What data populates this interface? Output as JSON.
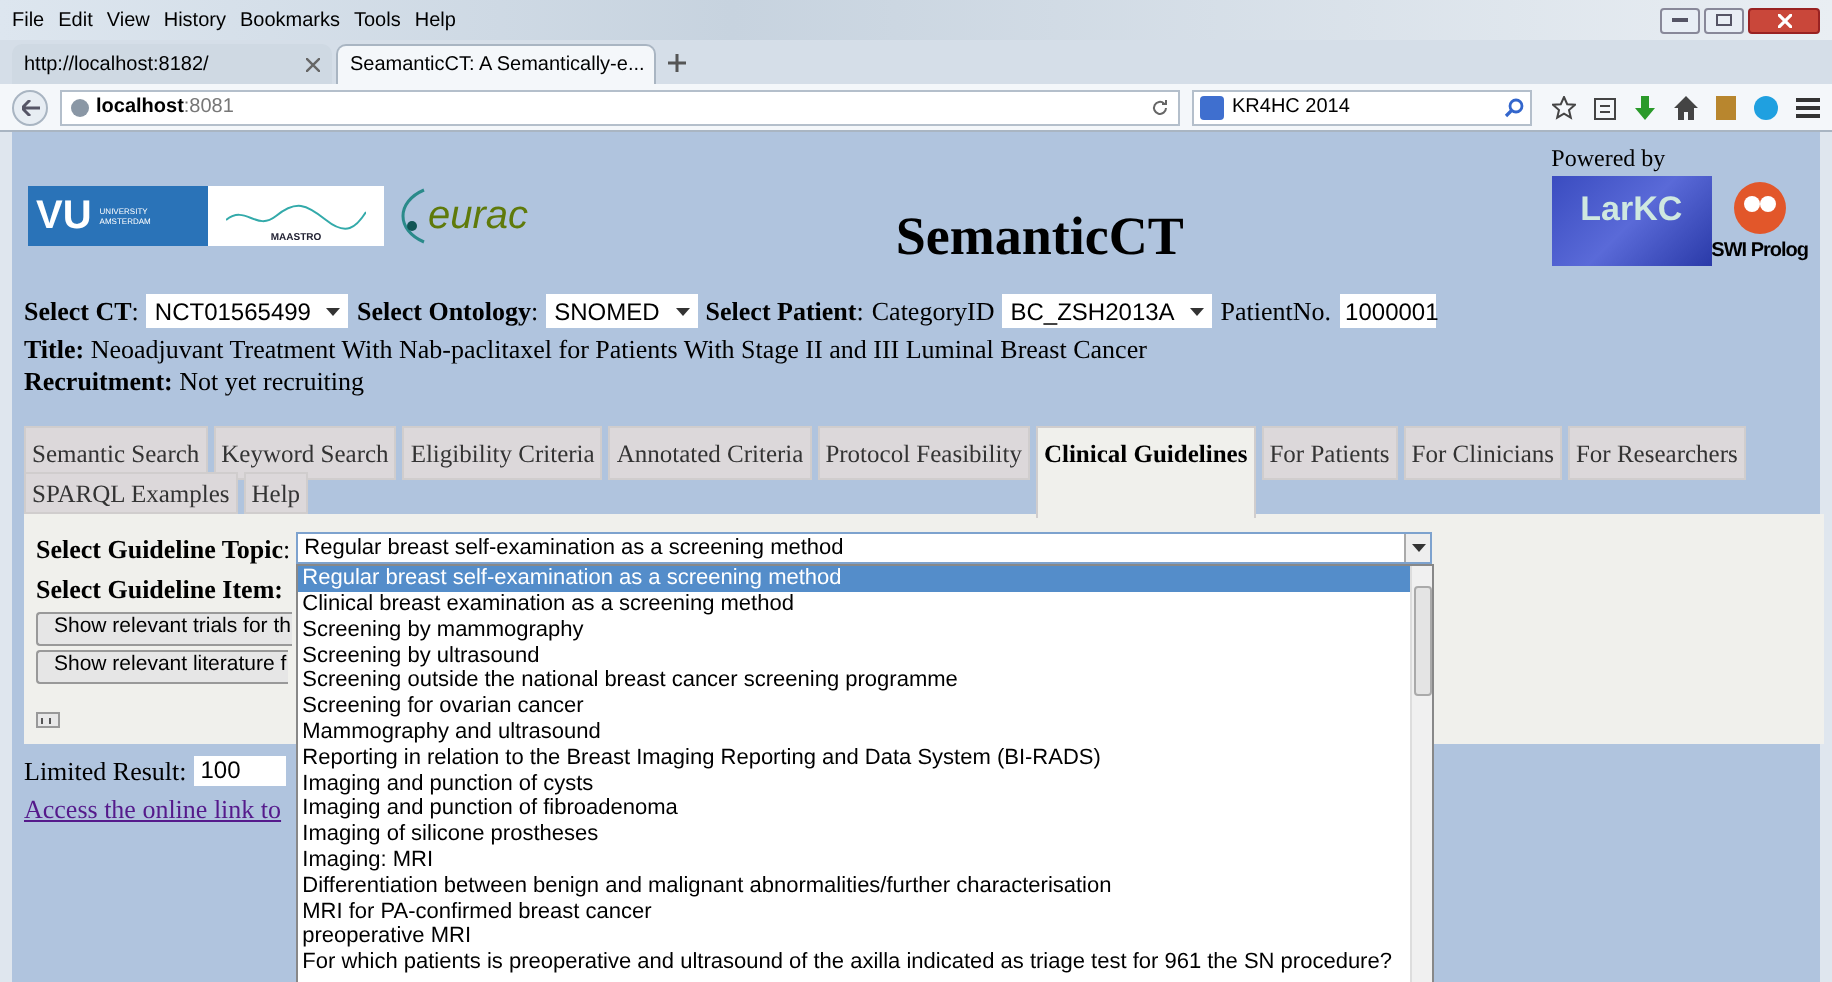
{
  "browser": {
    "menu": [
      "File",
      "Edit",
      "View",
      "History",
      "Bookmarks",
      "Tools",
      "Help"
    ],
    "tabs": [
      {
        "label": "http://localhost:8182/",
        "selected": false
      },
      {
        "label": "SeamanticCT: A Semantically-e...",
        "selected": true
      }
    ],
    "address": {
      "host": "localhost",
      "port": ":8081"
    },
    "search": {
      "value": "KR4HC 2014"
    }
  },
  "header": {
    "logo_vu": "VU",
    "logo_vu_sub": [
      "UNIVERSITY",
      "AMSTERDAM"
    ],
    "logo_maastro": "MAASTRO",
    "logo_eurac": "eurac",
    "title": "SemanticCT",
    "powered_by": "Powered by",
    "logo_larkc": "LarKC",
    "logo_swi": "SWI Prolog"
  },
  "selectors": {
    "ct_label": "**Select CT**:",
    "ct_value": "NCT01565499",
    "ontology_label": "**Select Ontology**:",
    "ontology_value": "SNOMED",
    "patient_label": "**Select Patient**:",
    "category_label": "CategoryID",
    "category_value": "BC_ZSH2013A",
    "patient_no_label": "PatientNo.",
    "patient_no_value": "1000001"
  },
  "trial": {
    "title_label": "Title:",
    "title": "Neoadjuvant Treatment With Nab-paclitaxel for Patients With Stage II and III Luminal Breast Cancer",
    "recruitment_label": "Recruitment:",
    "recruitment": "Not yet recruiting"
  },
  "tab_rows": [
    [
      {
        "label": "Semantic Search",
        "selected": false
      },
      {
        "label": "Keyword Search",
        "selected": false
      },
      {
        "label": "Eligibility Criteria",
        "selected": false
      },
      {
        "label": "Annotated Criteria",
        "selected": false
      },
      {
        "label": "Protocol Feasibility",
        "selected": false
      },
      {
        "label": "Clinical Guidelines",
        "selected": true
      },
      {
        "label": "For Patients",
        "selected": false
      },
      {
        "label": "For Clinicians",
        "selected": false
      },
      {
        "label": "For Researchers",
        "selected": false
      }
    ],
    [
      {
        "label": "SPARQL Examples",
        "selected": false
      },
      {
        "label": "Help",
        "selected": false
      }
    ]
  ],
  "guideline": {
    "topic_label": "**Select Guideline Topic**:",
    "topic_value": "Regular breast self-examination as a screening method",
    "item_label": "Select Guideline Item:",
    "buttons": [
      "Show relevant trials for th",
      "Show relevant literature f"
    ],
    "options": [
      {
        "label": "Regular breast self-examination as a screening method",
        "selected": true
      },
      {
        "label": "Clinical breast examination as a screening method",
        "selected": false
      },
      {
        "label": "Screening by mammography",
        "selected": false
      },
      {
        "label": "Screening by ultrasound",
        "selected": false
      },
      {
        "label": "Screening outside the national breast cancer screening programme",
        "selected": false
      },
      {
        "label": "Screening for ovarian cancer",
        "selected": false
      },
      {
        "label": "Mammography and ultrasound",
        "selected": false
      },
      {
        "label": "Reporting in relation to the Breast Imaging Reporting and Data System (BI-RADS)",
        "selected": false
      },
      {
        "label": "Imaging and punction of cysts",
        "selected": false
      },
      {
        "label": "Imaging and punction of fibroadenoma",
        "selected": false
      },
      {
        "label": "Imaging of silicone prostheses",
        "selected": false
      },
      {
        "label": "Imaging: MRI",
        "selected": false
      },
      {
        "label": "Differentiation between benign and malignant abnormalities/further characterisation",
        "selected": false
      },
      {
        "label": "MRI for PA-confirmed breast cancer",
        "selected": false
      },
      {
        "label": "preoperative MRI",
        "selected": false
      },
      {
        "label": "For which patients is preoperative and ultrasound of the axilla indicated as triage test for 961 the SN procedure?",
        "selected": false
      }
    ]
  },
  "limited_result": {
    "label": "Limited Result:",
    "value": "100"
  },
  "link": "Access the online link to"
}
